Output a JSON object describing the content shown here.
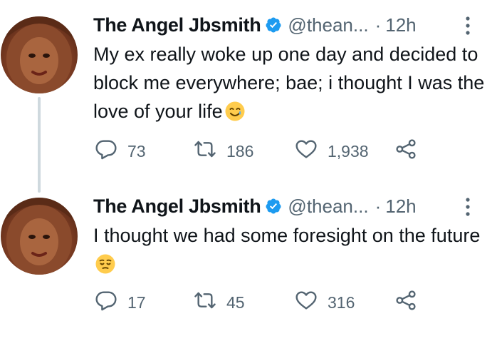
{
  "tweets": [
    {
      "name": "The Angel Jbsmith",
      "handle": "@thean...",
      "separator": "·",
      "time": "12h",
      "text": "My ex really woke up one day and decided to block me everywhere; bae; i thought I was the love of your life",
      "emoji": "smiling-face-with-tear",
      "replies": "73",
      "retweets": "186",
      "likes": "1,938"
    },
    {
      "name": "The Angel Jbsmith",
      "handle": "@thean...",
      "separator": "·",
      "time": "12h",
      "text": "I thought we had some foresight on the future",
      "emoji": "pensive-face",
      "replies": "17",
      "retweets": "45",
      "likes": "316"
    }
  ],
  "colors": {
    "text_primary": "#0f1419",
    "text_secondary": "#536471",
    "verified_blue": "#1d9bf0",
    "thread_line": "#cfd9de"
  }
}
